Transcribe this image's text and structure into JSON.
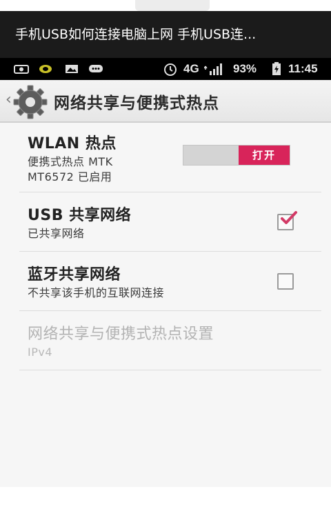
{
  "video_title": "手机USB如何连接电脑上网 手机USB连...",
  "status_bar": {
    "left_icons": [
      "camera-icon",
      "status-dot-icon",
      "image-icon",
      "chat-icon"
    ],
    "alarm_icon": "alarm-icon",
    "network": "4G",
    "signal_icon": "signal-bars-icon",
    "battery_percent": "93%",
    "battery_icon": "battery-icon",
    "time": "11:45"
  },
  "action_bar": {
    "back_glyph": "‹",
    "title": "网络共享与便携式热点",
    "icon": "settings-gear-icon"
  },
  "settings": [
    {
      "title": "WLAN 热点",
      "subtitle_lines": [
        "便携式热点 MTK",
        "MT6572 已启用"
      ],
      "control": "toggle",
      "toggle_label": "打开",
      "enabled": true
    },
    {
      "title": "USB 共享网络",
      "subtitle_lines": [
        "已共享网络"
      ],
      "control": "checkbox",
      "checked": true
    },
    {
      "title": "蓝牙共享网络",
      "subtitle_lines": [
        "不共享该手机的互联网连接"
      ],
      "control": "checkbox",
      "checked": false
    },
    {
      "title": "网络共享与便携式热点设置",
      "subtitle_lines": [
        "IPv4"
      ],
      "disabled": true
    }
  ],
  "colors": {
    "toggle_on": "#d8245a",
    "checkmark": "#d23a66",
    "title_bar_bg": "#1b1b1b",
    "status_bar_bg": "#000000"
  }
}
